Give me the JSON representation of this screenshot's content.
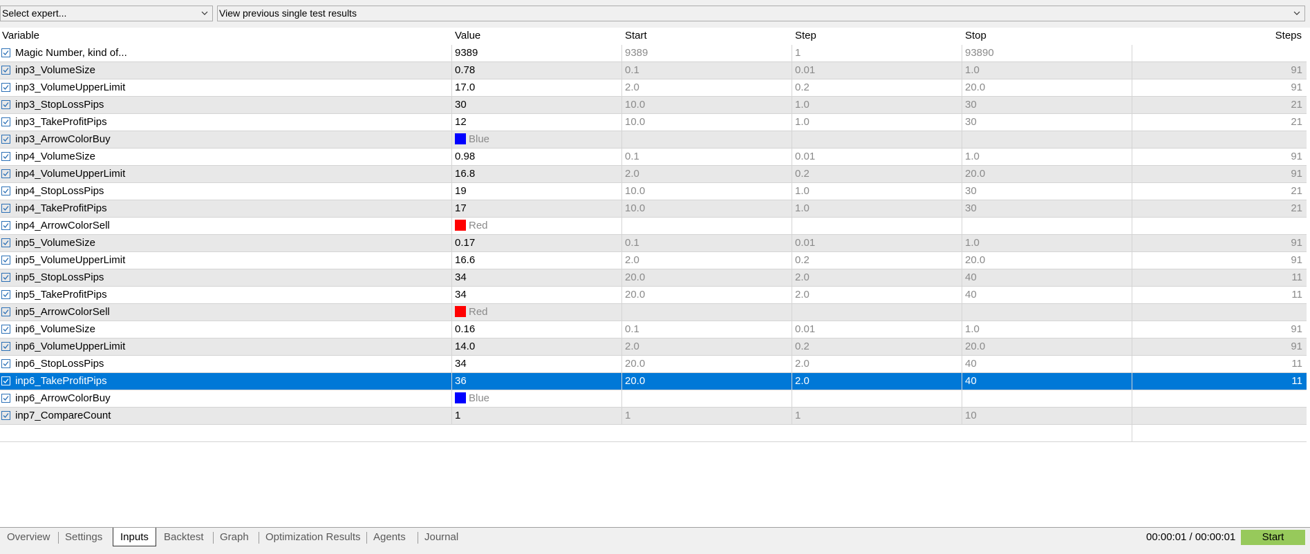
{
  "toolbar": {
    "expert_select_value": "Select expert...",
    "view_select_value": "View previous single test results"
  },
  "columns": [
    "Variable",
    "Value",
    "Start",
    "Step",
    "Stop",
    "Steps"
  ],
  "rows": [
    {
      "name": "Magic Number, kind of...",
      "value": "9389",
      "start": "9389",
      "step": "1",
      "stop": "93890",
      "steps": ""
    },
    {
      "name": "inp3_VolumeSize",
      "value": "0.78",
      "start": "0.1",
      "step": "0.01",
      "stop": "1.0",
      "steps": "91"
    },
    {
      "name": "inp3_VolumeUpperLimit",
      "value": "17.0",
      "start": "2.0",
      "step": "0.2",
      "stop": "20.0",
      "steps": "91"
    },
    {
      "name": "inp3_StopLossPips",
      "value": "30",
      "start": "10.0",
      "step": "1.0",
      "stop": "30",
      "steps": "21"
    },
    {
      "name": "inp3_TakeProfitPips",
      "value": "12",
      "start": "10.0",
      "step": "1.0",
      "stop": "30",
      "steps": "21"
    },
    {
      "name": "inp3_ArrowColorBuy",
      "value": "Blue",
      "color": "#0000ff",
      "start": "",
      "step": "",
      "stop": "",
      "steps": ""
    },
    {
      "name": "inp4_VolumeSize",
      "value": "0.98",
      "start": "0.1",
      "step": "0.01",
      "stop": "1.0",
      "steps": "91"
    },
    {
      "name": "inp4_VolumeUpperLimit",
      "value": "16.8",
      "start": "2.0",
      "step": "0.2",
      "stop": "20.0",
      "steps": "91"
    },
    {
      "name": "inp4_StopLossPips",
      "value": "19",
      "start": "10.0",
      "step": "1.0",
      "stop": "30",
      "steps": "21"
    },
    {
      "name": "inp4_TakeProfitPips",
      "value": "17",
      "start": "10.0",
      "step": "1.0",
      "stop": "30",
      "steps": "21"
    },
    {
      "name": "inp4_ArrowColorSell",
      "value": "Red",
      "color": "#ff0000",
      "start": "",
      "step": "",
      "stop": "",
      "steps": ""
    },
    {
      "name": "inp5_VolumeSize",
      "value": "0.17",
      "start": "0.1",
      "step": "0.01",
      "stop": "1.0",
      "steps": "91"
    },
    {
      "name": "inp5_VolumeUpperLimit",
      "value": "16.6",
      "start": "2.0",
      "step": "0.2",
      "stop": "20.0",
      "steps": "91"
    },
    {
      "name": "inp5_StopLossPips",
      "value": "34",
      "start": "20.0",
      "step": "2.0",
      "stop": "40",
      "steps": "11"
    },
    {
      "name": "inp5_TakeProfitPips",
      "value": "34",
      "start": "20.0",
      "step": "2.0",
      "stop": "40",
      "steps": "11"
    },
    {
      "name": "inp5_ArrowColorSell",
      "value": "Red",
      "color": "#ff0000",
      "start": "",
      "step": "",
      "stop": "",
      "steps": ""
    },
    {
      "name": "inp6_VolumeSize",
      "value": "0.16",
      "start": "0.1",
      "step": "0.01",
      "stop": "1.0",
      "steps": "91"
    },
    {
      "name": "inp6_VolumeUpperLimit",
      "value": "14.0",
      "start": "2.0",
      "step": "0.2",
      "stop": "20.0",
      "steps": "91"
    },
    {
      "name": "inp6_StopLossPips",
      "value": "34",
      "start": "20.0",
      "step": "2.0",
      "stop": "40",
      "steps": "11"
    },
    {
      "name": "inp6_TakeProfitPips",
      "value": "36",
      "start": "20.0",
      "step": "2.0",
      "stop": "40",
      "steps": "11",
      "selected": true
    },
    {
      "name": "inp6_ArrowColorBuy",
      "value": "Blue",
      "color": "#0000ff",
      "start": "",
      "step": "",
      "stop": "",
      "steps": ""
    },
    {
      "name": "inp7_CompareCount",
      "value": "1",
      "start": "1",
      "step": "1",
      "stop": "10",
      "steps": ""
    }
  ],
  "tabs": [
    {
      "label": "Overview"
    },
    {
      "label": "Settings"
    },
    {
      "label": "Inputs",
      "active": true
    },
    {
      "label": "Backtest"
    },
    {
      "label": "Graph"
    },
    {
      "label": "Optimization Results"
    },
    {
      "label": "Agents"
    },
    {
      "label": "Journal"
    }
  ],
  "status": {
    "timer": "00:00:01 / 00:00:01",
    "start_label": "Start"
  },
  "colors": {
    "selection": "#0078d7",
    "start_button": "#97c95b",
    "checkbox": "#2a6fb5"
  }
}
